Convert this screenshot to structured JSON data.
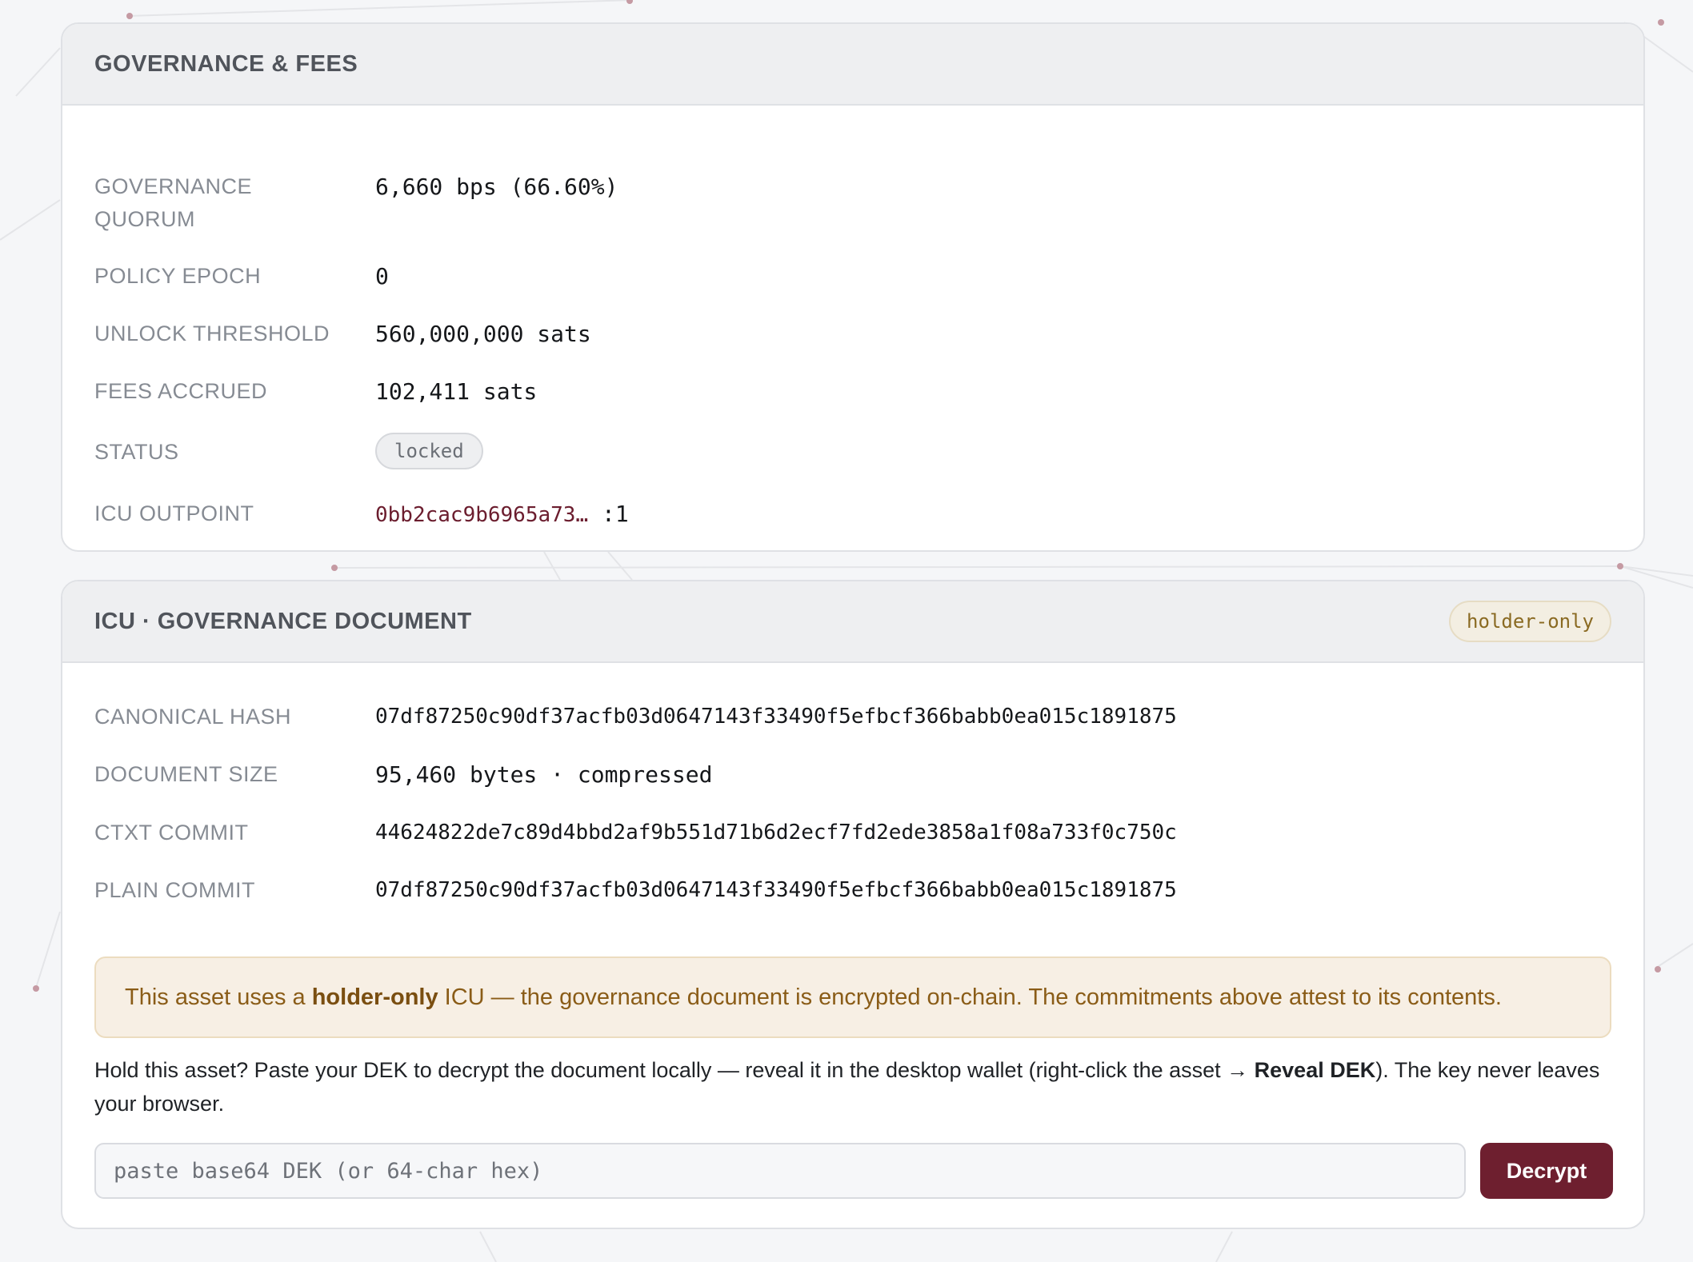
{
  "governance_card": {
    "title": "GOVERNANCE & FEES",
    "rows": [
      {
        "label": "Governance Quorum",
        "value": "6,660 bps (66.60%)"
      },
      {
        "label": "Policy Epoch",
        "value": "0"
      },
      {
        "label": "Unlock Threshold",
        "value": "560,000,000 sats"
      },
      {
        "label": "Fees Accrued",
        "value": "102,411 sats"
      },
      {
        "label": "Status",
        "value": "locked"
      },
      {
        "label": "ICU Outpoint",
        "value": "0bb2cac9b6965a73…",
        "suffix": ":1"
      }
    ]
  },
  "document_card": {
    "title": "ICU · GOVERNANCE DOCUMENT",
    "badge": "holder-only",
    "rows": [
      {
        "label": "Canonical Hash",
        "value": "07df87250c90df37acfb03d0647143f33490f5efbcf366babb0ea015c1891875"
      },
      {
        "label": "Document Size",
        "value": "95,460 bytes · compressed"
      },
      {
        "label": "CTXT Commit",
        "value": "44624822de7c89d4bbd2af9b551d71b6d2ecf7fd2ede3858a1f08a733f0c750c"
      },
      {
        "label": "Plain Commit",
        "value": "07df87250c90df37acfb03d0647143f33490f5efbcf366babb0ea015c1891875"
      }
    ],
    "notice": {
      "prefix": "This asset uses a ",
      "bold": "holder-only",
      "suffix": " ICU — the governance document is encrypted on-chain. The commitments above attest to its contents."
    },
    "helper": {
      "text": "Hold this asset? Paste your DEK to decrypt the document locally — reveal it in the desktop wallet (right-click the asset → ",
      "bold": "Reveal DEK",
      "tail": "). The key never leaves your browser."
    },
    "dek_input": {
      "placeholder": "paste base64 DEK (or 64-char hex)",
      "value": ""
    },
    "decrypt_label": "Decrypt"
  },
  "colors": {
    "accent": "#6e1f2f",
    "notice_bg": "#f7efe4",
    "notice_text": "#8a5c17",
    "label_gray": "#868b93"
  }
}
